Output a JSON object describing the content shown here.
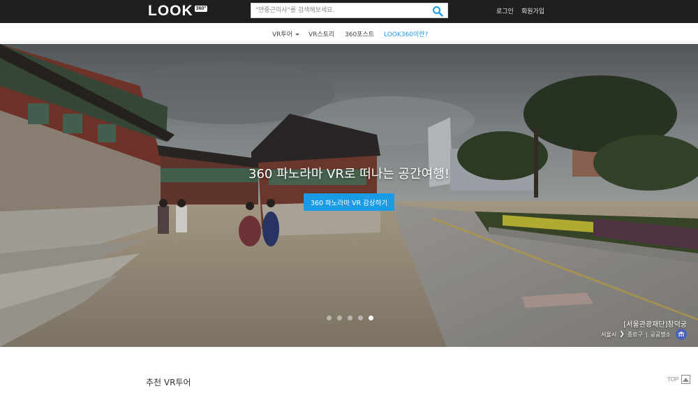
{
  "header": {
    "logo_text": "LOOK",
    "logo_badge": "360°",
    "search_placeholder": "\"안중근의사\"를 검색해보세요.",
    "login": "로그인",
    "signup": "회원가입"
  },
  "nav": {
    "items": [
      {
        "label": "VR투어",
        "has_dropdown": true
      },
      {
        "label": "VR스토리"
      },
      {
        "label": "360포스트"
      },
      {
        "label": "LOOK360이란?"
      }
    ]
  },
  "hero": {
    "title": "360 파노라마 VR로 떠나는 공간여행!",
    "button_label": "360 파노라마 VR 감상하기",
    "slide_count": 5,
    "active_slide": 5,
    "caption_title": "[서울관광재단]창덕궁",
    "caption_region": "서울시",
    "caption_district": "종로구",
    "caption_separator": "|",
    "caption_category": "공공명소"
  },
  "section": {
    "title": "추천 VR투어"
  },
  "top_button": {
    "label": "TOP"
  },
  "colors": {
    "accent": "#1a9be6",
    "header_bg": "#1f1f1f"
  },
  "icons": [
    "search-icon",
    "caret-down-icon",
    "chevron-right-icon",
    "place-category-icon",
    "arrow-up-icon"
  ]
}
